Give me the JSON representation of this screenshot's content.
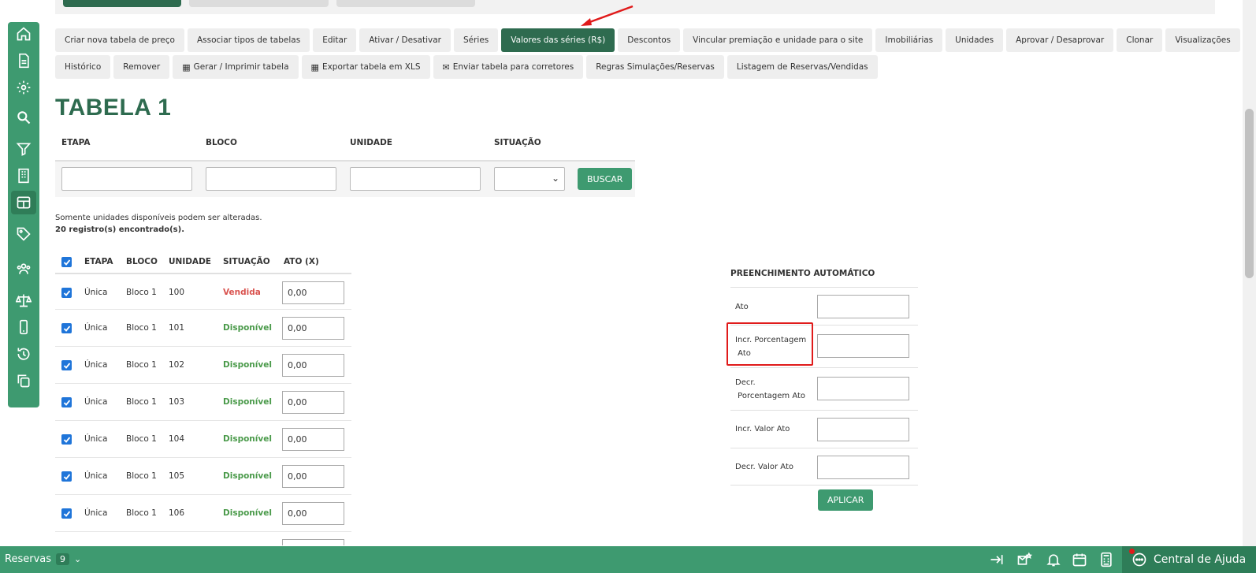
{
  "toolbar_row1": [
    {
      "label": "Criar nova tabela de preço",
      "active": false
    },
    {
      "label": "Associar tipos de tabelas",
      "active": false
    },
    {
      "label": "Editar",
      "active": false
    },
    {
      "label": "Ativar / Desativar",
      "active": false
    },
    {
      "label": "Séries",
      "active": false
    },
    {
      "label": "Valores das séries (R$)",
      "active": true
    },
    {
      "label": "Descontos",
      "active": false
    },
    {
      "label": "Vincular premiação e unidade para o site",
      "active": false
    },
    {
      "label": "Imobiliárias",
      "active": false
    },
    {
      "label": "Unidades",
      "active": false
    },
    {
      "label": "Aprovar / Desaprovar",
      "active": false
    },
    {
      "label": "Clonar",
      "active": false
    },
    {
      "label": "Visualizações",
      "active": false
    }
  ],
  "toolbar_row2": [
    {
      "label": "Histórico",
      "icon": ""
    },
    {
      "label": "Remover",
      "icon": ""
    },
    {
      "label": "Gerar / Imprimir tabela",
      "icon": "calculator-icon"
    },
    {
      "label": "Exportar tabela em XLS",
      "icon": "calculator-icon"
    },
    {
      "label": "Enviar tabela para corretores",
      "icon": "envelope-icon"
    },
    {
      "label": "Regras Simulações/Reservas",
      "icon": ""
    },
    {
      "label": "Listagem de Reservas/Vendidas",
      "icon": ""
    }
  ],
  "page": {
    "title": "TABELA 1"
  },
  "filters": {
    "etapa": "ETAPA",
    "bloco": "BLOCO",
    "unidade": "UNIDADE",
    "situacao": "SITUAÇÃO",
    "search_button": "BUSCAR"
  },
  "notes": {
    "info": "Somente unidades disponíveis podem ser alteradas.",
    "count": "20 registro(s) encontrado(s)."
  },
  "table": {
    "headers": {
      "etapa": "ETAPA",
      "bloco": "BLOCO",
      "unidade": "UNIDADE",
      "situacao": "SITUAÇÃO",
      "ato": "ATO (X)"
    },
    "rows": [
      {
        "etapa": "Única",
        "bloco": "Bloco 1",
        "unidade": "100",
        "situacao": "Vendida",
        "status": "sold",
        "ato": "0,00"
      },
      {
        "etapa": "Única",
        "bloco": "Bloco 1",
        "unidade": "101",
        "situacao": "Disponível",
        "status": "available",
        "ato": "0,00"
      },
      {
        "etapa": "Única",
        "bloco": "Bloco 1",
        "unidade": "102",
        "situacao": "Disponível",
        "status": "available",
        "ato": "0,00"
      },
      {
        "etapa": "Única",
        "bloco": "Bloco 1",
        "unidade": "103",
        "situacao": "Disponível",
        "status": "available",
        "ato": "0,00"
      },
      {
        "etapa": "Única",
        "bloco": "Bloco 1",
        "unidade": "104",
        "situacao": "Disponível",
        "status": "available",
        "ato": "0,00"
      },
      {
        "etapa": "Única",
        "bloco": "Bloco 1",
        "unidade": "105",
        "situacao": "Disponível",
        "status": "available",
        "ato": "0,00"
      },
      {
        "etapa": "Única",
        "bloco": "Bloco 1",
        "unidade": "106",
        "situacao": "Disponível",
        "status": "available",
        "ato": "0,00"
      }
    ]
  },
  "auto_fill": {
    "title": "PREENCHIMENTO AUTOMÁTICO",
    "fields": [
      {
        "label": "Ato"
      },
      {
        "label": "Incr. Porcentagem\n Ato"
      },
      {
        "label": "Decr.\n Porcentagem Ato"
      },
      {
        "label": "Incr. Valor Ato"
      },
      {
        "label": "Decr. Valor Ato"
      }
    ],
    "apply_button": "APLICAR"
  },
  "bottom_bar": {
    "reservas_label": "Reservas",
    "reservas_count": "9",
    "help_label": "Central de Ajuda"
  },
  "sidebar_icons": [
    "home-icon",
    "document-icon",
    "gear-icon",
    "search-icon",
    "filter-icon",
    "building-icon",
    "table-icon",
    "tag-icon",
    "users-icon",
    "scale-icon",
    "mobile-icon",
    "history-icon",
    "copy-icon"
  ],
  "colors": {
    "brand_green": "#3e9a70",
    "dark_green": "#2e6b4f",
    "sold_red": "#d9534f",
    "available_green": "#4a9a4a",
    "annotation_red": "#e01b1b"
  }
}
